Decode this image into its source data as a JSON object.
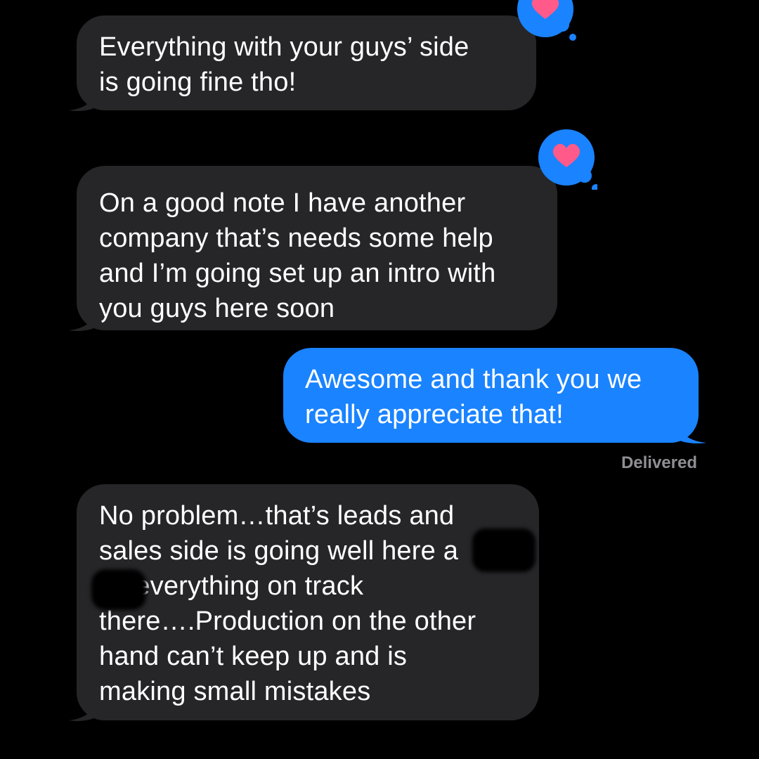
{
  "thread": {
    "messages": [
      {
        "direction": "incoming",
        "text": "Everything with your guys’ side\nis going fine tho!",
        "reaction": "heart"
      },
      {
        "direction": "incoming",
        "text": "On a good note I have another\ncompany that’s needs some help\nand I’m going set up an intro with\nyou guys here soon",
        "reaction": "heart"
      },
      {
        "direction": "outgoing",
        "text": "Awesome and thank you we\nreally appreciate that!",
        "status": "Delivered"
      },
      {
        "direction": "incoming",
        "text": "No problem…that’s leads and\nsales side is going well here a\n     so everything on track\nthere….Production on the other\nhand can’t keep up and is\nmaking small mistakes",
        "redacted": true
      }
    ]
  },
  "colors": {
    "incoming_bubble": "#262629",
    "outgoing_bubble": "#1a83ff",
    "tapback_bg": "#1a83ff",
    "heart": "#ff5a8a",
    "status_text": "#8e8e93",
    "background": "#000000"
  },
  "icons": {
    "reaction": "heart-icon"
  }
}
